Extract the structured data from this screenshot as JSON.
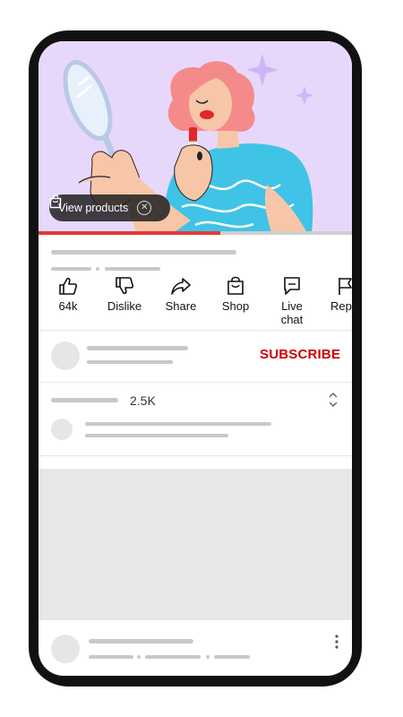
{
  "video": {
    "view_products_label": "View products",
    "progress_fraction": 0.58
  },
  "actions": [
    {
      "label": "64k",
      "icon": "thumbs-up-icon"
    },
    {
      "label": "Dislike",
      "icon": "thumbs-down-icon"
    },
    {
      "label": "Share",
      "icon": "share-icon"
    },
    {
      "label": "Shop",
      "icon": "shopping-bag-icon"
    },
    {
      "label": "Live chat",
      "icon": "chat-icon"
    },
    {
      "label": "Repo",
      "icon": "flag-icon"
    }
  ],
  "channel": {
    "subscribe_label": "SUBSCRIBE"
  },
  "comments": {
    "count": "2.5K"
  },
  "colors": {
    "accent_red": "#cc0000",
    "video_bg": "#e7d8fb",
    "placeholder": "#c8c8c8"
  }
}
